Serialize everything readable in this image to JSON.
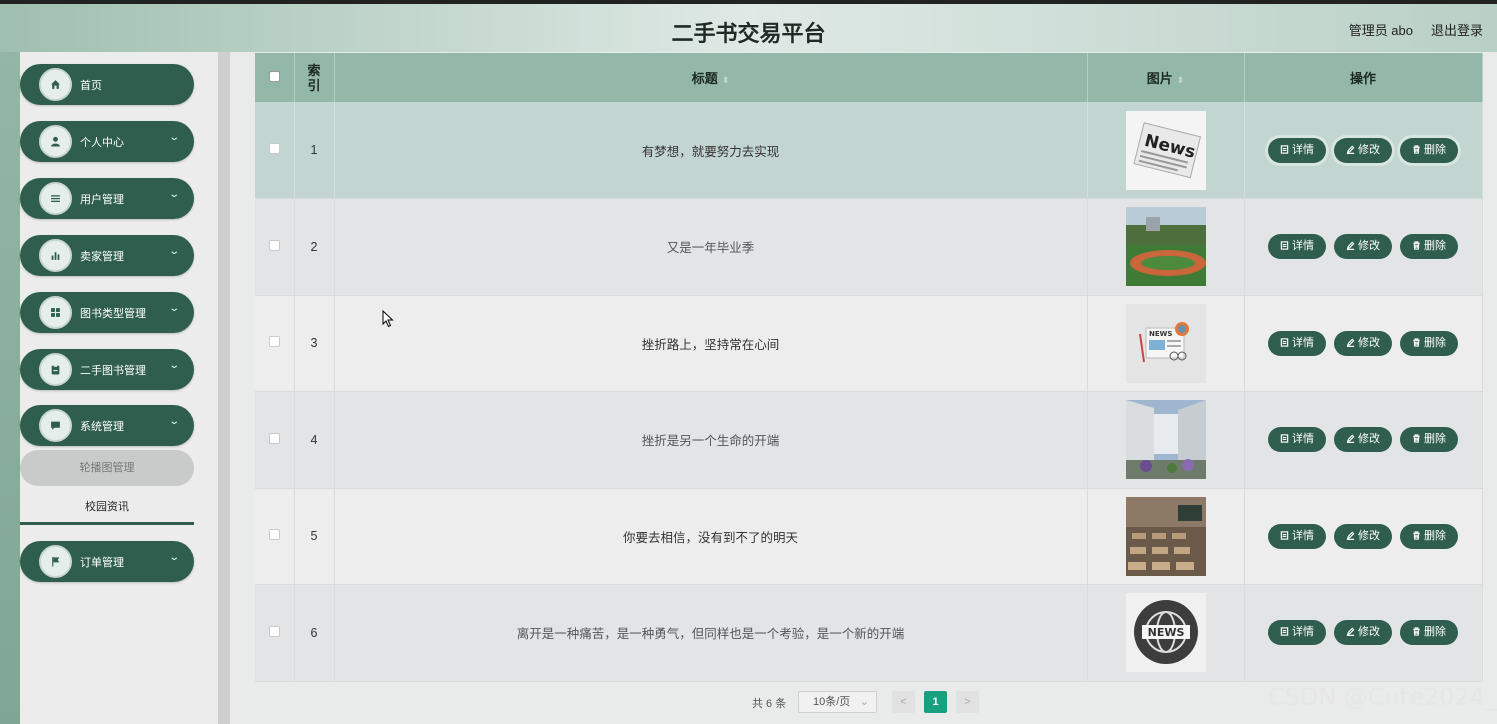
{
  "header": {
    "title": "二手书交易平台",
    "admin": "管理员 abo",
    "logout": "退出登录"
  },
  "sidebar": {
    "items": [
      {
        "label": "首页",
        "icon": "home-icon",
        "expandable": false
      },
      {
        "label": "个人中心",
        "icon": "person-icon",
        "expandable": true
      },
      {
        "label": "用户管理",
        "icon": "list-icon",
        "expandable": true
      },
      {
        "label": "卖家管理",
        "icon": "bar-chart-icon",
        "expandable": true
      },
      {
        "label": "图书类型管理",
        "icon": "grid-icon",
        "expandable": true
      },
      {
        "label": "二手图书管理",
        "icon": "clipboard-icon",
        "expandable": true
      },
      {
        "label": "系统管理",
        "icon": "chat-icon",
        "expandable": true
      },
      {
        "label": "订单管理",
        "icon": "flag-icon",
        "expandable": true
      }
    ],
    "submenu": [
      "轮播图管理",
      "校园资讯"
    ]
  },
  "table": {
    "columns": [
      "索引",
      "标题",
      "图片",
      "操作"
    ],
    "rows": [
      {
        "index": "1",
        "title": "有梦想，就要努力去实现",
        "image": "newspaper-thumbnail"
      },
      {
        "index": "2",
        "title": "又是一年毕业季",
        "image": "campus-field-thumbnail"
      },
      {
        "index": "3",
        "title": "挫折路上，坚持常在心间",
        "image": "news-illustration-thumbnail"
      },
      {
        "index": "4",
        "title": "挫折是另一个生命的开端",
        "image": "courtyard-thumbnail"
      },
      {
        "index": "5",
        "title": "你要去相信，没有到不了的明天",
        "image": "classroom-thumbnail"
      },
      {
        "index": "6",
        "title": "离开是一种痛苦，是一种勇气，但同样也是一个考验，是一个新的开端",
        "image": "news-globe-thumbnail"
      }
    ],
    "actions": {
      "detail": "详情",
      "edit": "修改",
      "delete": "删除"
    }
  },
  "pagination": {
    "total": "共 6 条",
    "page_size": "10条/页",
    "current_page": "1",
    "prev": "<",
    "next": ">"
  },
  "watermark": "CSDN @Cute2024_",
  "colors": {
    "primary": "#2f5e4e",
    "header_bg": "#93b8a9",
    "highlight_row": "#c3d5d0",
    "active_page": "#19a07f"
  }
}
